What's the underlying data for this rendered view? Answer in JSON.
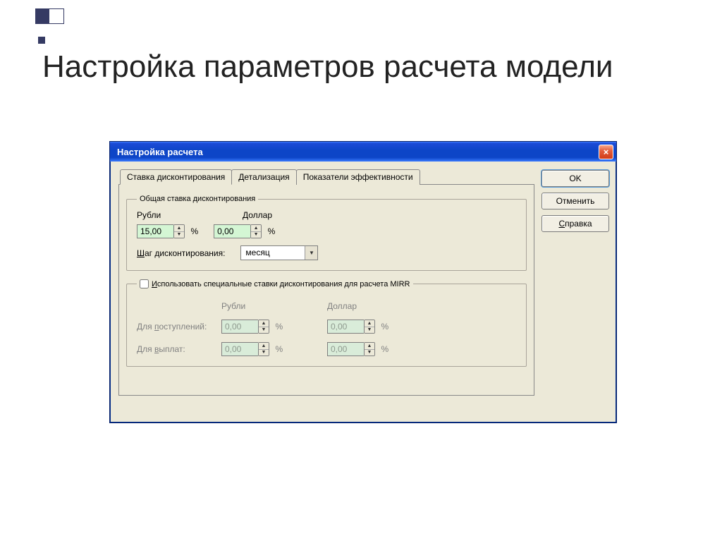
{
  "slide_title": "Настройка параметров расчета модели",
  "window": {
    "title": "Настройка расчета",
    "close_label": "×",
    "tabs": {
      "discount": "Ставка дисконтирования",
      "detail": "Детализация",
      "eff": "Показатели эффективности"
    },
    "group_general": {
      "legend": "Общая ставка дисконтирования",
      "rub_label": "Рубли",
      "usd_label": "Доллар",
      "rub_value": "15,00",
      "usd_value": "0,00",
      "percent": "%",
      "step_label": "Шаг дисконтирования:",
      "step_value": "месяц"
    },
    "group_mirr": {
      "legend": "Использовать специальные ставки дисконтирования для расчета MIRR",
      "rub_label": "Рубли",
      "usd_label": "Доллар",
      "receipts_label": "Для поступлений:",
      "payments_label": "Для выплат:",
      "receipts_rub": "0,00",
      "receipts_usd": "0,00",
      "payments_rub": "0,00",
      "payments_usd": "0,00",
      "percent": "%"
    },
    "buttons": {
      "ok": "OK",
      "cancel": "Отменить",
      "help": "Справка"
    }
  }
}
